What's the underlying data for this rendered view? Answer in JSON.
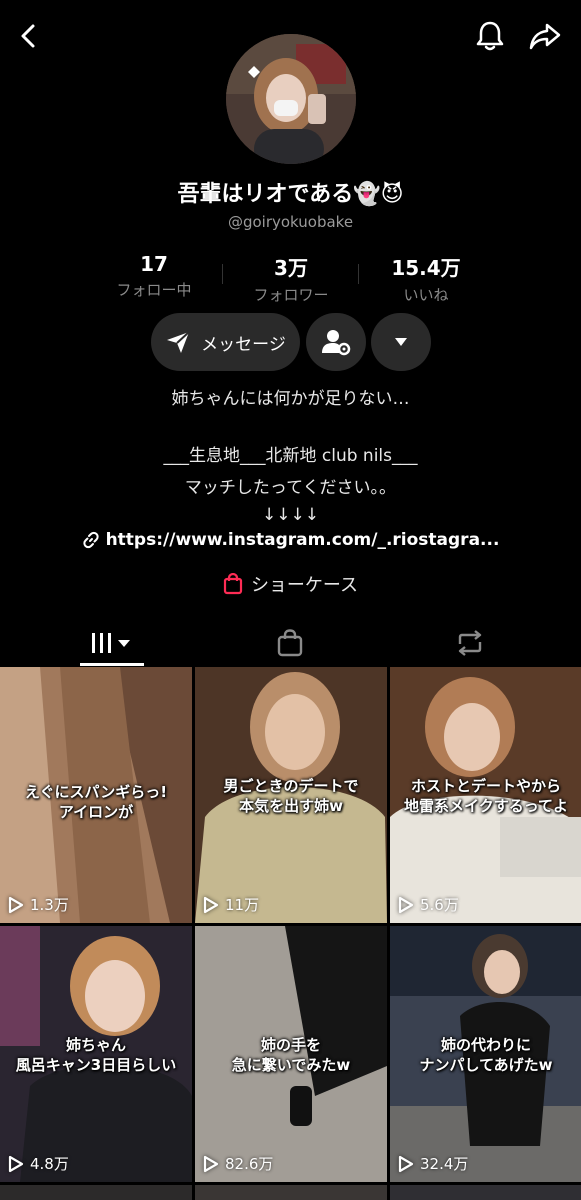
{
  "profile": {
    "display_name": "吾輩はリオである👻😈",
    "handle": "@goiryokuobake"
  },
  "stats": [
    {
      "value": "17",
      "label": "フォロー中"
    },
    {
      "value": "3万",
      "label": "フォロワー"
    },
    {
      "value": "15.4万",
      "label": "いいね"
    }
  ],
  "actions": {
    "message_label": "メッセージ"
  },
  "bio": {
    "line1": "姉ちゃんには何かが足りない…",
    "line2": "___生息地___北新地 club nils___",
    "line3": "マッチしたってください。。",
    "line4": "↓↓↓↓",
    "link": "https://www.instagram.com/_.riostagra..."
  },
  "showcase": {
    "label": "ショーケース",
    "accent": "#fe2c55"
  },
  "videos": [
    {
      "caption": "えぐにスパンギらっ!\nアイロンが",
      "views": "1.3万"
    },
    {
      "caption": "男ごときのデートで\n本気を出す姉w",
      "views": "11万"
    },
    {
      "caption": "ホストとデートやから\n地雷系メイクするってよ",
      "views": "5.6万"
    },
    {
      "caption": "姉ちゃん\n風呂キャン3日目らしい",
      "views": "4.8万"
    },
    {
      "caption": "姉の手を\n急に繋いでみたw",
      "views": "82.6万"
    },
    {
      "caption": "姉の代わりに\nナンパしてあげたw",
      "views": "32.4万"
    }
  ]
}
